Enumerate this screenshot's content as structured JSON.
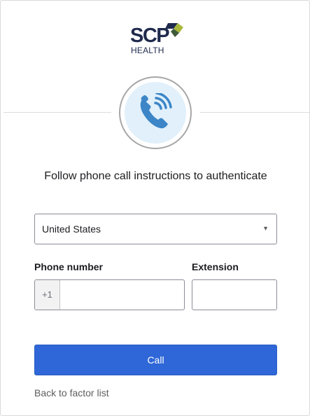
{
  "logo": {
    "name": "SCP",
    "subtitle": "HEALTH",
    "mark_colors": [
      "#1f2a4d",
      "#a8b83a",
      "#3f5a3a"
    ]
  },
  "factor_icon": {
    "icon": "phone-call-icon",
    "color": "#3c86c8",
    "background": "#e1f0fb"
  },
  "title": "Follow phone call instructions to authenticate",
  "country": {
    "selected": "United States"
  },
  "phone": {
    "label": "Phone number",
    "prefix": "+1",
    "value": ""
  },
  "extension": {
    "label": "Extension",
    "value": ""
  },
  "call_button": {
    "label": "Call",
    "color": "#2f67d8"
  },
  "back_link": {
    "label": "Back to factor list"
  }
}
